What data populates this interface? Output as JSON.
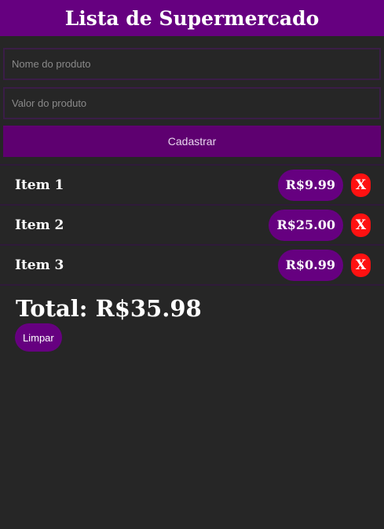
{
  "header": {
    "title": "Lista de Supermercado"
  },
  "form": {
    "name_placeholder": "Nome do produto",
    "value_placeholder": "Valor do produto",
    "submit_label": "Cadastrar"
  },
  "items": [
    {
      "name": "Item 1",
      "price": "R$9.99",
      "remove_label": "X"
    },
    {
      "name": "Item 2",
      "price": "R$25.00",
      "remove_label": "X"
    },
    {
      "name": "Item 3",
      "price": "R$0.99",
      "remove_label": "X"
    }
  ],
  "summary": {
    "total": "Total: R$35.98",
    "clear_label": "Limpar"
  },
  "colors": {
    "background": "#262626",
    "primary": "#660080",
    "danger": "#ff1111",
    "text": "#ffffff"
  }
}
